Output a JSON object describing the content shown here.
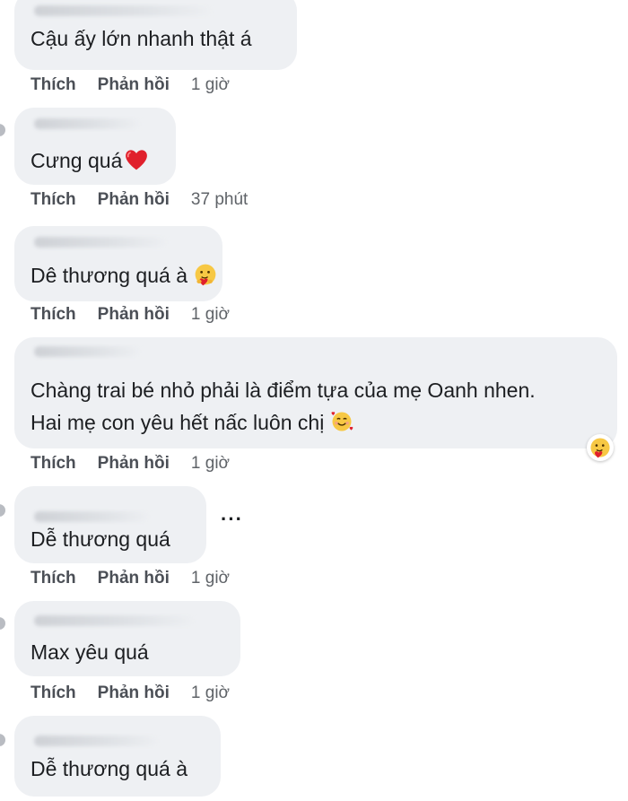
{
  "comments": [
    {
      "text": "Cậu ấy lớn nhanh thật á",
      "like": "Thích",
      "reply": "Phản hồi",
      "time": "1 giờ"
    },
    {
      "text": "Cưng quá",
      "emoji": "red-heart-icon",
      "like": "Thích",
      "reply": "Phản hồi",
      "time": "37 phút"
    },
    {
      "text": "Dê thương quá à",
      "emoji": "hugging-heart-face-icon",
      "like": "Thích",
      "reply": "Phản hồi",
      "time": "1 giờ"
    },
    {
      "text_line1": "Chàng trai bé nhỏ phải là điểm tựa của mẹ Oanh nhen.",
      "text_line2": "Hai mẹ con yêu hết nấc luôn chị",
      "emoji": "smiling-face-with-hearts-icon",
      "reaction": "care-reaction-icon",
      "like": "Thích",
      "reply": "Phản hồi",
      "time": "1 giờ"
    },
    {
      "text": "Dễ thương quá",
      "more": "···",
      "like": "Thích",
      "reply": "Phản hồi",
      "time": "1 giờ"
    },
    {
      "text": "Max yêu quá",
      "like": "Thích",
      "reply": "Phản hồi",
      "time": "1 giờ"
    },
    {
      "text": "Dễ thương quá à"
    }
  ]
}
